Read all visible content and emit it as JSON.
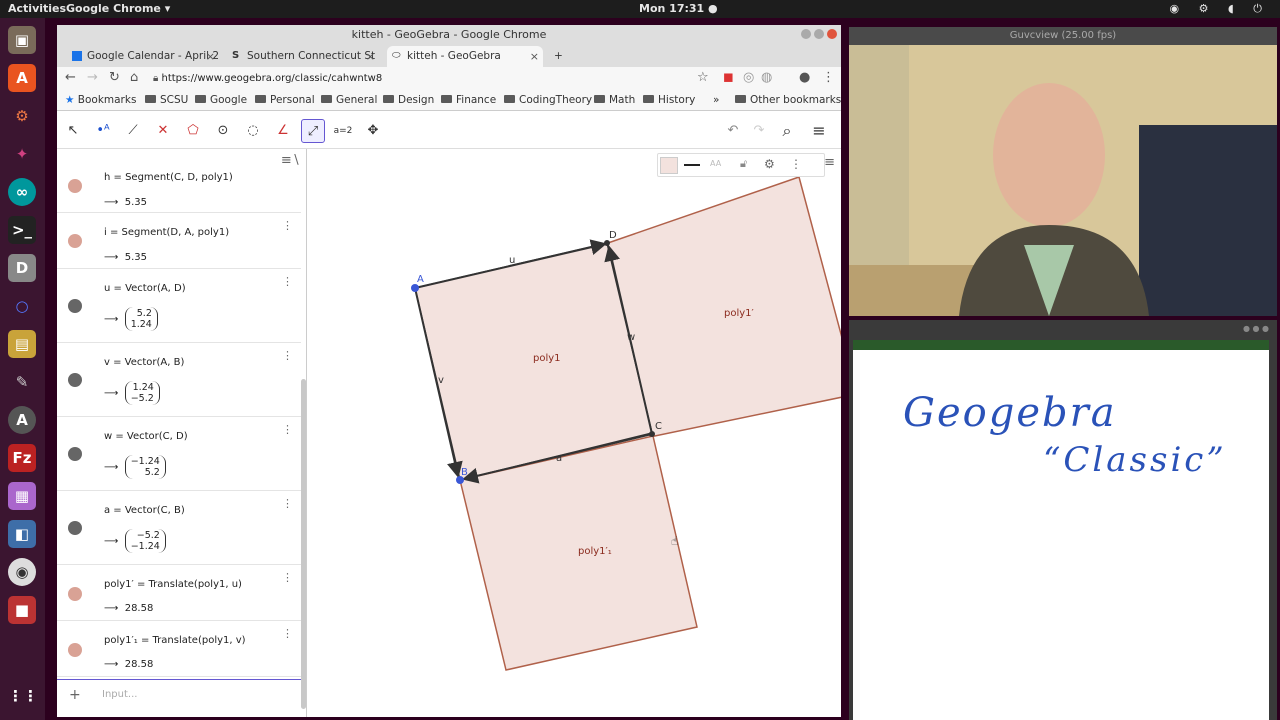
{
  "topbar": {
    "activities": "Activities",
    "app": "Google Chrome ▾",
    "clock": "Mon 17:31 ●"
  },
  "window": {
    "title": "kitteh - GeoGebra - Google Chrome"
  },
  "tabs": [
    {
      "label": "Google Calendar - April 2(",
      "icon": "calendar-icon"
    },
    {
      "label": "Southern Connecticut St",
      "icon": "s-icon"
    },
    {
      "label": "kitteh - GeoGebra",
      "icon": "geogebra-icon"
    }
  ],
  "url": "https://www.geogebra.org/classic/cahwntw8",
  "bookmarks": [
    "Bookmarks",
    "SCSU",
    "Google",
    "Personal",
    "General",
    "Design",
    "Finance",
    "CodingTheory",
    "Math",
    "History",
    "»",
    "Other bookmarks"
  ],
  "algebra": {
    "rows": [
      {
        "def": "h = Segment(C, D, poly1)",
        "val": "5.35",
        "color": "#d9a295"
      },
      {
        "def": "i = Segment(D, A, poly1)",
        "val": "5.35",
        "color": "#d9a295"
      },
      {
        "def": "u = Vector(A, D)",
        "v1": "5.2",
        "v2": "1.24",
        "color": "#666"
      },
      {
        "def": "v = Vector(A, B)",
        "v1": "1.24",
        "v2": "−5.2",
        "color": "#666"
      },
      {
        "def": "w = Vector(C, D)",
        "v1": "−1.24",
        "v2": "5.2",
        "color": "#666"
      },
      {
        "def": "a = Vector(C, B)",
        "v1": "−5.2",
        "v2": "−1.24",
        "color": "#666"
      },
      {
        "def": "poly1′ = Translate(poly1, u)",
        "val": "28.58",
        "color": "#d9a295"
      },
      {
        "def": "poly1′₁ = Translate(poly1, v)",
        "val": "28.58",
        "color": "#d9a295"
      }
    ],
    "arrow": "⟶",
    "input_placeholder": "Input..."
  },
  "graphics": {
    "points": {
      "A": "A",
      "B": "B",
      "C": "C",
      "D": "D"
    },
    "polys": {
      "p1": "poly1",
      "p2": "poly1′",
      "p3": "poly1′₁"
    },
    "vectors": {
      "u": "u",
      "v": "v",
      "w": "w",
      "a": "a"
    }
  },
  "camera": {
    "title": "Guvcview  (25.00 fps)"
  },
  "whiteboard": {
    "line1": "Geogebra",
    "line2": "“Classic”"
  },
  "colors": {
    "accent": "#6557d2",
    "poly_fill": "#f3e2de",
    "poly_edge": "#b0614a"
  }
}
